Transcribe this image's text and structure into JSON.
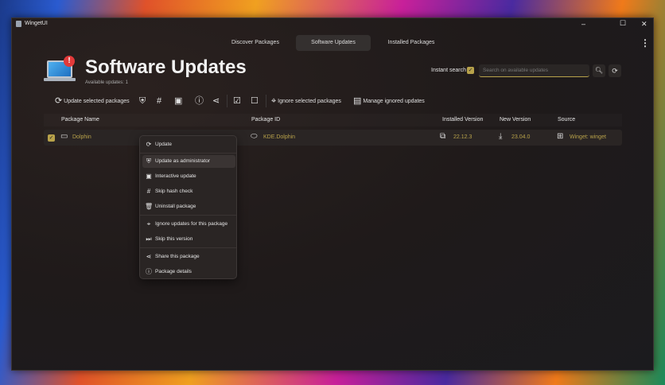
{
  "window": {
    "title": "WingetUI",
    "minimize": "–",
    "maximize": "☐",
    "close": "✕"
  },
  "tabs": [
    {
      "label": "Discover Packages"
    },
    {
      "label": "Software Updates",
      "selected": true
    },
    {
      "label": "Installed Packages"
    }
  ],
  "header": {
    "title": "Software Updates",
    "subtitle": "Available updates: 1",
    "badge": "!"
  },
  "search": {
    "instant_label": "Instant search",
    "instant_checked": true,
    "placeholder": "Search on available updates",
    "value": ""
  },
  "toolbar": {
    "update_selected": "Update selected packages",
    "ignore_selected": "Ignore selected packages",
    "manage_ignored": "Manage ignored updates"
  },
  "table": {
    "columns": [
      "Package Name",
      "Package ID",
      "Installed Version",
      "New Version",
      "Source"
    ],
    "rows": [
      {
        "checked": true,
        "name": "Dolphin",
        "id": "KDE.Dolphin",
        "installed": "22.12.3",
        "new": "23.04.0",
        "source": "Winget: winget"
      }
    ]
  },
  "context_menu": [
    "Update",
    "Update as administrator",
    "Interactive update",
    "Skip hash check",
    "Uninstall package",
    "Ignore updates for this package",
    "Skip this version",
    "Share this package",
    "Package details"
  ],
  "colors": {
    "accent": "#b8a24a",
    "window_bg": "#1f1a1a"
  }
}
